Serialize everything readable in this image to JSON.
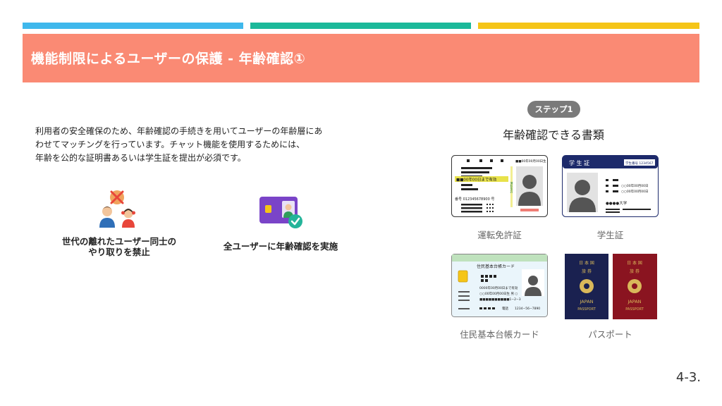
{
  "header": {
    "title": "機能制限によるユーザーの保護 - 年齢確認①",
    "accent_colors": [
      "#3fb8ec",
      "#1bb99a",
      "#f5c518"
    ],
    "band_color": "#fa8a74"
  },
  "intro": {
    "lines": [
      "利用者の安全確保のため、年齢確認の手続きを用いてユーザーの年齢層にあ",
      "わせてマッチングを行っています。チャット機能を使用するためには、",
      "年齢を公的な証明書あるいは学生証を提出が必須です。"
    ]
  },
  "features": [
    {
      "icon": "no-contact-people-icon",
      "label_lines": [
        "世代の離れたユーザー同士の",
        "やり取りを禁止"
      ]
    },
    {
      "icon": "id-verified-icon",
      "label_lines": [
        "全ユーザーに年齢確認を実施"
      ]
    }
  ],
  "step": {
    "badge": "ステップ1",
    "title": "年齢確認できる書類"
  },
  "documents": [
    {
      "icon": "drivers-license-icon",
      "caption": "運転免許証",
      "card_text": {
        "valid": "■■00年00日まで有効",
        "number": "番号 012345678900 号",
        "header_no": "■■00年00月00日生",
        "side": "運転免許"
      }
    },
    {
      "icon": "student-id-icon",
      "caption": "学生証",
      "card_text": {
        "title": "学 生 証",
        "number": "学生番号 1234567",
        "row1": "○○00年00月00日",
        "row2": "○○00年00月00日",
        "univ": "●●●●大学"
      }
    },
    {
      "icon": "resident-card-icon",
      "caption": "住民基本台帳カード",
      "card_text": {
        "title": "住民基本台帳カード",
        "valid": "0000年00月00日まで有効",
        "birth": "○○00年00月00日生 男 ○",
        "addr": "■■■■■■■■■■1−2−3",
        "tel_label": "電話",
        "tel": "1234−56−7890"
      }
    },
    {
      "icon": "passport-icon",
      "caption": "パスポート",
      "card_text": {
        "top": "日 本 国",
        "mid": "旅 券",
        "country": "JAPAN",
        "label": "PASSPORT"
      }
    }
  ],
  "page": {
    "number": "4-3."
  }
}
